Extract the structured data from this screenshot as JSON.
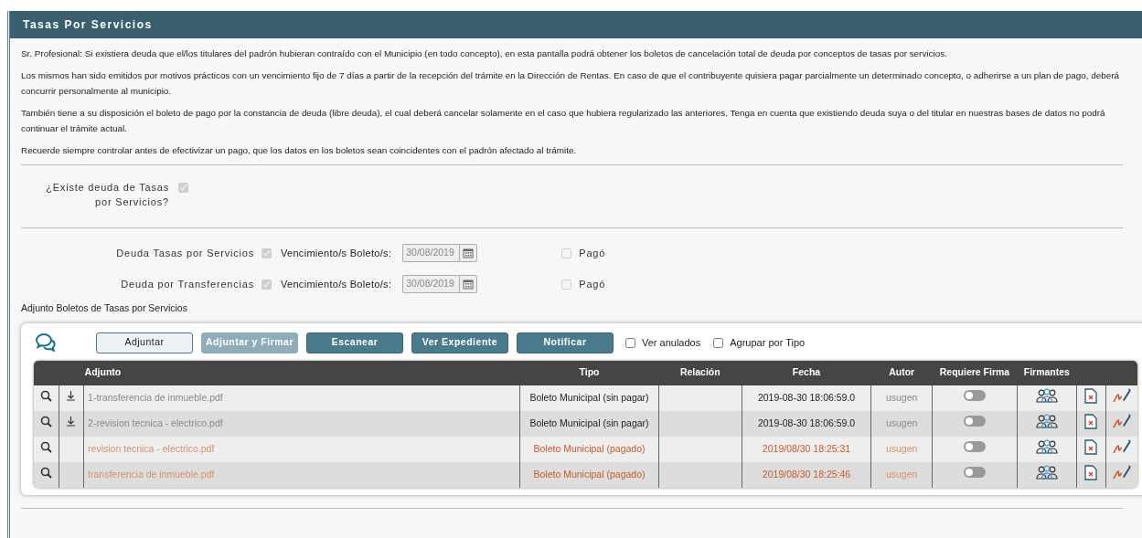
{
  "header": {
    "title": "Tasas Por Servicios"
  },
  "paragraphs": [
    "Sr. Profesional: Si existiera deuda que el/los titulares del padrón hubieran contraído con el Municipio (en todo concepto), en esta pantalla podrá obtener los boletos de cancelación total de deuda por conceptos de tasas por servicios.",
    "Los mismos han sido emitidos por motivos prácticos con un vencimiento fijo de 7 días a partir de la recepción del trámite en la Dirección de Rentas. En caso de que el contribuyente quisiera pagar parcialmente un determinado concepto, o adherirse a un plan de pago, deberá concurrir personalmente al municipio.",
    "También tiene a su disposición el boleto de pago por la constancia de deuda (libre deuda), el cual deberá cancelar solamente en el caso que hubiera regularizado las anteriores. Tenga en cuenta que existiendo deuda suya o del titular en nuestras bases de datos no podrá continuar el trámite actual.",
    "Recuerde siempre controlar antes de efectivizar un pago, que los datos en los boletos sean coincidentes con el padrón afectado al trámite."
  ],
  "existe_deuda": {
    "label": "¿Existe deuda de Tasas por Servicios?",
    "checked": true
  },
  "deudas": [
    {
      "label": "Deuda Tasas por Servicios",
      "checked": true,
      "due_label": "Vencimiento/s Boleto/s:",
      "due_date": "30/08/2019",
      "paid_label": "Pagó",
      "paid": false
    },
    {
      "label": "Deuda por Transferencias",
      "checked": true,
      "due_label": "Vencimiento/s Boleto/s:",
      "due_date": "30/08/2019",
      "paid_label": "Pagó",
      "paid": false
    }
  ],
  "attachments": {
    "title": "Adjunto Boletos de Tasas por Servicios",
    "buttons": [
      {
        "label": "Adjuntar",
        "kind": "outline"
      },
      {
        "label": "Adjuntar y Firmar",
        "kind": "disabled"
      },
      {
        "label": "Escanear",
        "kind": "primary"
      },
      {
        "label": "Ver Expediente",
        "kind": "primary"
      },
      {
        "label": "Notificar",
        "kind": "primary"
      }
    ],
    "options": [
      {
        "label": "Ver anulados",
        "checked": false
      },
      {
        "label": "Agrupar por Tipo",
        "checked": false
      }
    ],
    "columns": [
      "Adjunto",
      "Tipo",
      "Relación",
      "Fecha",
      "Autor",
      "Requiere Firma",
      "Firmantes"
    ],
    "rows": [
      {
        "file": "1-transferencia de inmueble.pdf",
        "tipo": "Boleto Municipal (sin pagar)",
        "fecha": "2019-08-30 18:06:59.0",
        "autor": "usugen",
        "paid": false,
        "downloadable": true,
        "requires_signature": false
      },
      {
        "file": "2-revision tecnica - electrico.pdf",
        "tipo": "Boleto Municipal (sin pagar)",
        "fecha": "2019-08-30 18:06:59.0",
        "autor": "usugen",
        "paid": false,
        "downloadable": true,
        "requires_signature": false
      },
      {
        "file": "revision tecnica - electrico.pdf",
        "tipo": "Boleto Municipal (pagado)",
        "fecha": "2019/08/30 18:25:31",
        "autor": "usugen",
        "paid": true,
        "downloadable": false,
        "requires_signature": false
      },
      {
        "file": "transferencia de inmueble.pdf",
        "tipo": "Boleto Municipal (pagado)",
        "fecha": "2019/08/30 18:25:46",
        "autor": "usugen",
        "paid": true,
        "downloadable": false,
        "requires_signature": false
      }
    ]
  }
}
